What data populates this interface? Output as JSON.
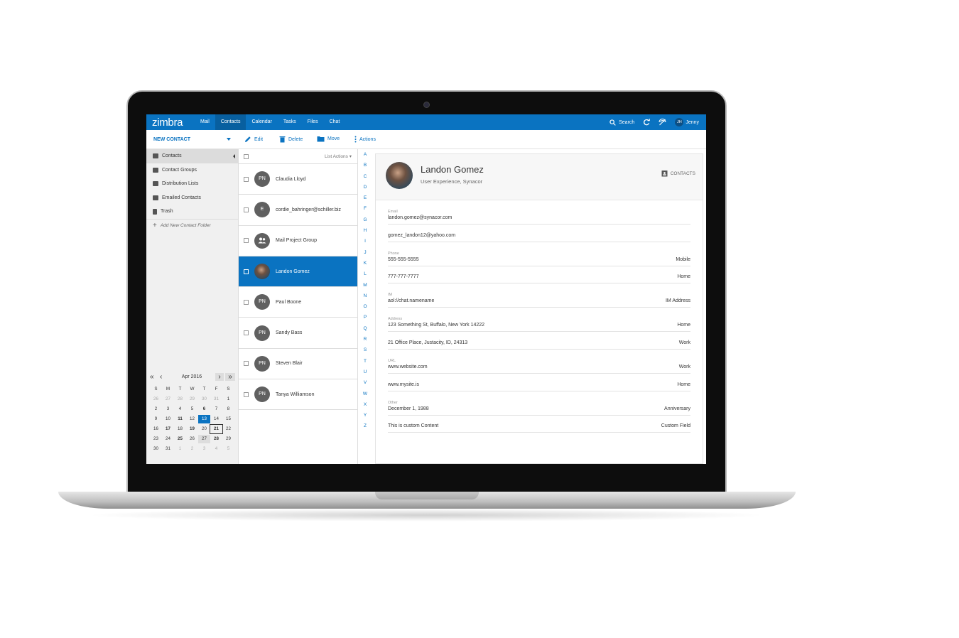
{
  "app": {
    "logo": "zimbra"
  },
  "nav": [
    "Mail",
    "Contacts",
    "Calendar",
    "Tasks",
    "Files",
    "Chat"
  ],
  "nav_active": "Contacts",
  "topbar": {
    "search_label": "Search",
    "user_initials": "JH",
    "user_name": "Jenny"
  },
  "toolbar": {
    "new_contact": "NEW CONTACT",
    "edit": "Edit",
    "delete": "Delete",
    "move": "Move",
    "actions": "Actions"
  },
  "sidebar": {
    "folders": [
      "Contacts",
      "Contact Groups",
      "Distribution Lists",
      "Emailed Contacts",
      "Trash"
    ],
    "add_folder": "Add New Contact Folder"
  },
  "calendar": {
    "month_label": "Apr 2016",
    "weekdays": [
      "S",
      "M",
      "T",
      "W",
      "T",
      "F",
      "S"
    ],
    "weeks": [
      [
        "26",
        "27",
        "28",
        "29",
        "30",
        "31",
        "1"
      ],
      [
        "2",
        "3",
        "4",
        "5",
        "6",
        "7",
        "8"
      ],
      [
        "9",
        "10",
        "11",
        "12",
        "13",
        "14",
        "15"
      ],
      [
        "16",
        "17",
        "18",
        "19",
        "20",
        "21",
        "22"
      ],
      [
        "23",
        "24",
        "25",
        "26",
        "27",
        "28",
        "29"
      ],
      [
        "30",
        "31",
        "1",
        "2",
        "3",
        "4",
        "5"
      ]
    ],
    "today": "13"
  },
  "list": {
    "actions_label": "List Actions",
    "contacts": [
      {
        "initials": "PN",
        "name": "Claudia Lloyd"
      },
      {
        "initials": "E",
        "name": "cordie_bahringer@schiller.biz"
      },
      {
        "initials": "",
        "name": "Mail Project Group"
      },
      {
        "initials": "",
        "name": "Landon Gomez",
        "selected": true
      },
      {
        "initials": "PN",
        "name": "Paul Boone"
      },
      {
        "initials": "PN",
        "name": "Sandy Bass"
      },
      {
        "initials": "PN",
        "name": "Steven Blair"
      },
      {
        "initials": "PN",
        "name": "Tanya Williamson"
      }
    ],
    "alphabet": [
      "A",
      "B",
      "C",
      "D",
      "E",
      "F",
      "G",
      "H",
      "I",
      "J",
      "K",
      "L",
      "M",
      "N",
      "O",
      "P",
      "Q",
      "R",
      "S",
      "T",
      "U",
      "V",
      "W",
      "X",
      "Y",
      "Z"
    ]
  },
  "detail": {
    "name": "Landon Gomez",
    "subtitle": "User Experience, Synacor",
    "tag": "CONTACTS",
    "sections": [
      {
        "label": "Email",
        "fields": [
          {
            "value": "landon.gomez@synacor.com",
            "type": ""
          },
          {
            "value": "gomez_landon12@yahoo.com",
            "type": ""
          }
        ]
      },
      {
        "label": "Phone",
        "fields": [
          {
            "value": "555-555-5555",
            "type": "Mobile"
          },
          {
            "value": "777-777-7777",
            "type": "Home"
          }
        ]
      },
      {
        "label": "IM",
        "fields": [
          {
            "value": "aol://chat.namename",
            "type": "IM Address"
          }
        ]
      },
      {
        "label": "Address",
        "fields": [
          {
            "value": "123 Something St, Buffalo, New York 14222",
            "type": "Home"
          },
          {
            "value": "21 Office Place, Justacity, ID, 24313",
            "type": "Work"
          }
        ]
      },
      {
        "label": "URL",
        "fields": [
          {
            "value": "www.website.com",
            "type": "Work"
          },
          {
            "value": "www.mysite.is",
            "type": "Home"
          }
        ]
      },
      {
        "label": "Other",
        "fields": [
          {
            "value": "December 1, 1988",
            "type": "Anniversary"
          },
          {
            "value": "This is custom Content",
            "type": "Custom Field"
          }
        ]
      }
    ]
  },
  "colors": {
    "accent": "#0a73c1",
    "nav_active": "#085f9f"
  }
}
